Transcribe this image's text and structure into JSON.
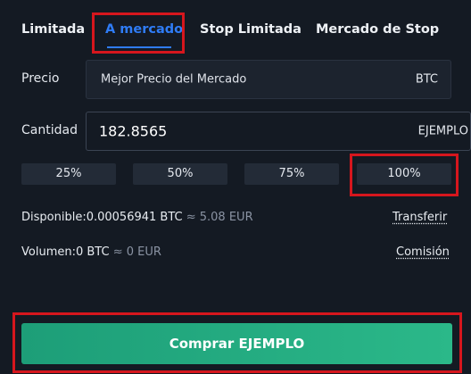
{
  "tabs": [
    {
      "label": "Limitada"
    },
    {
      "label": "A mercado"
    },
    {
      "label": "Stop Limitada"
    },
    {
      "label": "Mercado de Stop"
    }
  ],
  "price": {
    "label": "Precio",
    "value": "Mejor Precio del Mercado",
    "unit": "BTC"
  },
  "quantity": {
    "label": "Cantidad",
    "value": "182.8565",
    "unit": "EJEMPLO"
  },
  "percentages": [
    "25%",
    "50%",
    "75%",
    "100%"
  ],
  "available": {
    "label": "Disponible:",
    "value": "0.00056941 BTC",
    "approx": "≈ 5.08 EUR",
    "action": "Transferir"
  },
  "volume": {
    "label": "Volumen:",
    "value": "0 BTC",
    "approx": "≈ 0 EUR",
    "action": "Comisión"
  },
  "buy_button": {
    "label": "Comprar EJEMPLO"
  },
  "colors": {
    "background": "#141a23",
    "active_tab": "#2f7cf6",
    "highlight": "#d6161d",
    "buy": "#2bb889"
  }
}
